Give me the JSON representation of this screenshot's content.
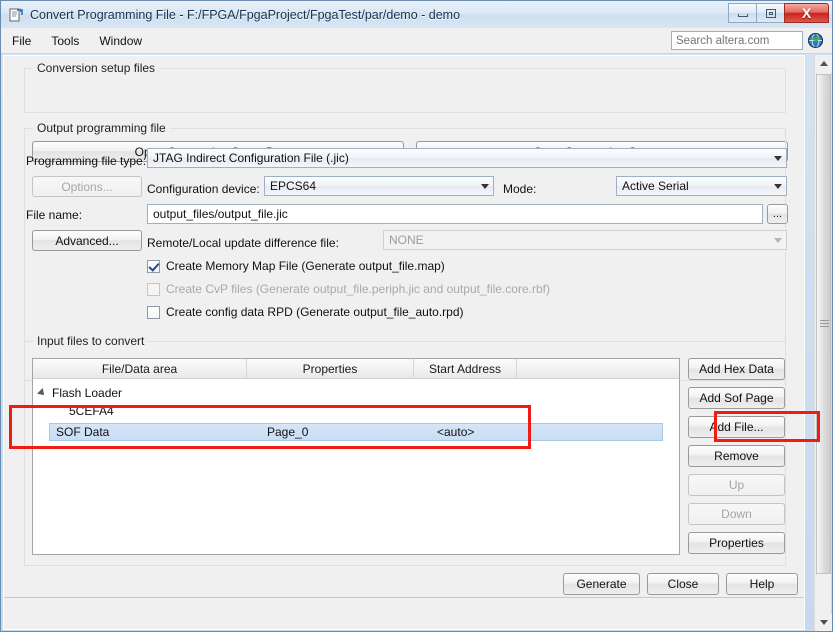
{
  "window": {
    "title": "Convert Programming File - F:/FPGA/FpgaProject/FpgaTest/par/demo - demo",
    "icon": "convert-programming-file-icon",
    "minimize_label": "",
    "maximize_label": "",
    "close_label": "X"
  },
  "menubar": {
    "items": [
      {
        "label": "File"
      },
      {
        "label": "Tools"
      },
      {
        "label": "Window"
      }
    ],
    "search": {
      "placeholder": "Search altera.com",
      "value": "",
      "icon": "globe-icon"
    }
  },
  "conversion_setup": {
    "group_title": "Conversion setup files",
    "open_button": "Open Conversion Setup Data...",
    "save_button": "Save Conversion Setup..."
  },
  "output_programming_file": {
    "group_title": "Output programming file",
    "programming_file_type_label": "Programming file type:",
    "programming_file_type_value": "JTAG Indirect Configuration File (.jic)",
    "options_button": "Options...",
    "configuration_device_label": "Configuration device:",
    "configuration_device_value": "EPCS64",
    "mode_label": "Mode:",
    "mode_value": "Active Serial",
    "file_name_label": "File name:",
    "file_name_value": "output_files/output_file.jic",
    "browse_button": "...",
    "advanced_button": "Advanced...",
    "remote_local_label": "Remote/Local update difference file:",
    "remote_local_value": "NONE",
    "checkboxes": [
      {
        "label": "Create Memory Map File (Generate output_file.map)",
        "checked": true,
        "enabled": true
      },
      {
        "label": "Create CvP files (Generate output_file.periph.jic and output_file.core.rbf)",
        "checked": false,
        "enabled": false
      },
      {
        "label": "Create config data RPD (Generate output_file_auto.rpd)",
        "checked": false,
        "enabled": true
      }
    ]
  },
  "input_files": {
    "group_title": "Input files to convert",
    "columns": [
      "File/Data area",
      "Properties",
      "Start Address"
    ],
    "rows": [
      {
        "name": "Flash Loader",
        "properties": "",
        "start_address": "",
        "type": "parent",
        "expanded": true
      },
      {
        "name": "5CEFA4",
        "properties": "",
        "start_address": "",
        "type": "child"
      },
      {
        "name": "SOF Data",
        "properties": "Page_0",
        "start_address": "<auto>",
        "type": "child",
        "selected": true
      }
    ],
    "side_buttons": [
      {
        "label": "Add Hex Data",
        "enabled": true
      },
      {
        "label": "Add Sof Page",
        "enabled": true
      },
      {
        "label": "Add File...",
        "enabled": true,
        "highlighted": true
      },
      {
        "label": "Remove",
        "enabled": true
      },
      {
        "label": "Up",
        "enabled": false
      },
      {
        "label": "Down",
        "enabled": false
      },
      {
        "label": "Properties",
        "enabled": true
      }
    ]
  },
  "footer": {
    "generate_button": "Generate",
    "close_button": "Close",
    "help_button": "Help"
  },
  "annotations": {
    "highlight_color": "#ee1c15",
    "boxes": [
      "selected-row-highlight",
      "add-file-button-highlight"
    ]
  }
}
